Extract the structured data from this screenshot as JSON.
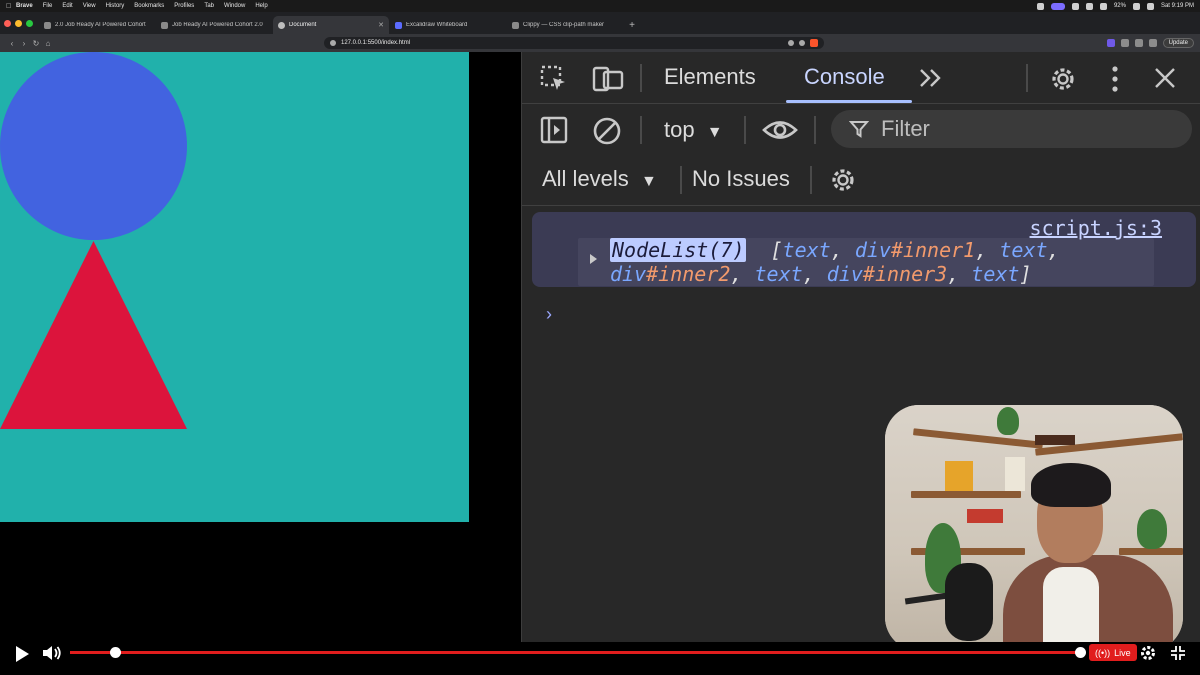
{
  "menubar": {
    "app": "Brave",
    "items": [
      "File",
      "Edit",
      "View",
      "History",
      "Bookmarks",
      "Profiles",
      "Tab",
      "Window",
      "Help"
    ],
    "battery": "92%",
    "clock": "Sat 9:19 PM"
  },
  "tabs": [
    {
      "label": "2.0 Job Ready AI Powered Cohort"
    },
    {
      "label": "Job Ready AI Powered Cohort 2.0"
    },
    {
      "label": "Document"
    },
    {
      "label": "Excalidraw Whiteboard"
    },
    {
      "label": "Clippy — CSS clip-path maker"
    }
  ],
  "address": {
    "url": "127.0.0.1:5500/index.html",
    "update_label": "Update"
  },
  "page": {
    "bg_color": "#21b1ab",
    "circle_color": "#4263e0",
    "triangle_color": "#dc143c"
  },
  "devtools": {
    "tabs": [
      "Elements",
      "Console"
    ],
    "active_tab": "Console",
    "context": "top",
    "filter_placeholder": "Filter",
    "levels": "All levels",
    "issues": "No Issues",
    "log": {
      "source": "script.js:3",
      "nodelist_label": "NodeList(7)",
      "line1": {
        "open": "[",
        "t1": "text",
        "d1": "div",
        "i1": "#inner1",
        "t2": "text"
      },
      "line2": {
        "d2": "div",
        "i2": "#inner2",
        "t3": "text",
        "d3": "div",
        "i3": "#inner3",
        "t4": "text",
        "close": "]"
      }
    },
    "prompt": "›"
  },
  "video": {
    "live_label": "Live",
    "progress": 0.045
  }
}
